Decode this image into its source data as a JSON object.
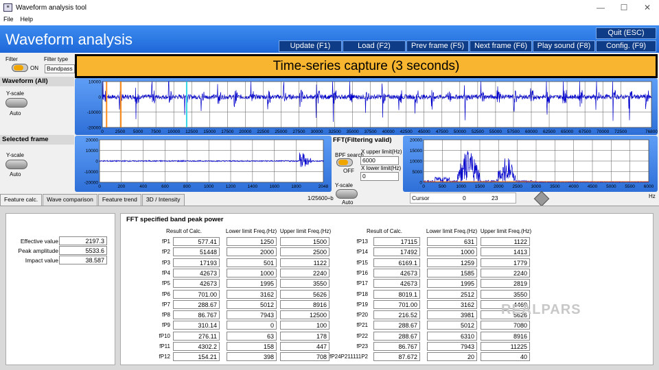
{
  "window": {
    "title": "Waveform analysis tool",
    "icon": "app-icon",
    "controls": [
      "—",
      "☐",
      "✕"
    ]
  },
  "menu": [
    "File",
    "Help"
  ],
  "header": {
    "title": "Waveform analysis",
    "buttons": {
      "quit": "Quit (ESC)",
      "update": "Update (F1)",
      "load": "Load (F2)",
      "prev": "Prev frame (F5)",
      "next": "Next frame (F6)",
      "play": "Play sound (F8)",
      "config": "Config. (F9)"
    },
    "bar_color": "#1d67d8",
    "button_color": "#0e3c87"
  },
  "filter": {
    "label": "Filter",
    "state": "ON",
    "type_label": "Filter type",
    "type_value": "Bandpass"
  },
  "banner": {
    "text": "Time-series capture (3 seconds)",
    "color": "#f7b530"
  },
  "waveform_panel": {
    "title": "Waveform (All)",
    "yscale_label": "Y-scale",
    "yscale_value": "Auto"
  },
  "selected_panel": {
    "title": "Selected frame",
    "yscale_label": "Y-scale",
    "yscale_value": "Auto",
    "sample_rate": "1/25600÷b"
  },
  "fft_panel": {
    "title": "FFT(Filtering valid)",
    "bpf_label": "BPF search",
    "bpf_state": "OFF",
    "xupper_label": "X upper limit(Hz)",
    "xupper_value": "6000",
    "xlower_label": "X lower limit(Hz)",
    "xlower_value": "0",
    "yscale_label": "Y-scale",
    "yscale_value": "Auto",
    "cursor_label": "Cursor",
    "cursor_x": "0",
    "cursor_y": "23",
    "unit": "Hz"
  },
  "tabs": [
    "Feature calc.",
    "Wave comparison",
    "Feature trend",
    "3D / Intensity"
  ],
  "active_tab": 0,
  "features": [
    {
      "label": "Effective value",
      "value": "2197.3"
    },
    {
      "label": "Peak amplitude",
      "value": "5533.6"
    },
    {
      "label": "Impact value",
      "value": "38.587"
    }
  ],
  "fft_table": {
    "title": "FFT specified band peak power",
    "headers": [
      "Result of Calc.",
      "Lower limit Freq.(Hz)",
      "Upper limit Freq.(Hz)"
    ],
    "left": [
      {
        "label": "fP1",
        "result": "577.41",
        "lower": "1250",
        "upper": "1500"
      },
      {
        "label": "fP2",
        "result": "51448",
        "lower": "2000",
        "upper": "2500"
      },
      {
        "label": "fP3",
        "result": "17193",
        "lower": "501",
        "upper": "1122"
      },
      {
        "label": "fP4",
        "result": "42673",
        "lower": "1000",
        "upper": "2240"
      },
      {
        "label": "fP5",
        "result": "42673",
        "lower": "1995",
        "upper": "3550"
      },
      {
        "label": "fP6",
        "result": "701.00",
        "lower": "3162",
        "upper": "5626"
      },
      {
        "label": "fP7",
        "result": "288.67",
        "lower": "5012",
        "upper": "8916"
      },
      {
        "label": "fP8",
        "result": "86.767",
        "lower": "7943",
        "upper": "12500"
      },
      {
        "label": "fP9",
        "result": "310.14",
        "lower": "0",
        "upper": "100"
      },
      {
        "label": "fP10",
        "result": "276.11",
        "lower": "63",
        "upper": "178"
      },
      {
        "label": "fP11",
        "result": "4302.2",
        "lower": "158",
        "upper": "447"
      },
      {
        "label": "fP12",
        "result": "154.21",
        "lower": "398",
        "upper": "708"
      }
    ],
    "right": [
      {
        "label": "fP13",
        "result": "17115",
        "lower": "631",
        "upper": "1122"
      },
      {
        "label": "fP14",
        "result": "17492",
        "lower": "1000",
        "upper": "1413"
      },
      {
        "label": "fP15",
        "result": "6169.1",
        "lower": "1259",
        "upper": "1779"
      },
      {
        "label": "fP16",
        "result": "42673",
        "lower": "1585",
        "upper": "2240"
      },
      {
        "label": "fP17",
        "result": "42673",
        "lower": "1995",
        "upper": "2819"
      },
      {
        "label": "fP18",
        "result": "8019.1",
        "lower": "2512",
        "upper": "3550"
      },
      {
        "label": "fP19",
        "result": "701.00",
        "lower": "3162",
        "upper": "4469"
      },
      {
        "label": "fP20",
        "result": "216.52",
        "lower": "3981",
        "upper": "5626"
      },
      {
        "label": "fP21",
        "result": "288.67",
        "lower": "5012",
        "upper": "7080"
      },
      {
        "label": "fP22",
        "result": "288.67",
        "lower": "6310",
        "upper": "8916"
      },
      {
        "label": "fP23",
        "result": "86.767",
        "lower": "7943",
        "upper": "11225"
      },
      {
        "label": "fP24P211111P2",
        "result": "87.672",
        "lower": "20",
        "upper": "40"
      }
    ]
  },
  "watermark": "REALPARS",
  "chart_data": [
    {
      "type": "line",
      "name_id": "waveform-all",
      "ylim": [
        -20000,
        10000
      ],
      "yticks": [
        10000,
        0,
        -10000,
        -20000
      ],
      "xlim": [
        0,
        76800
      ],
      "xticks": [
        0,
        2500,
        5000,
        7500,
        10000,
        12500,
        15000,
        17500,
        20000,
        22500,
        25000,
        27500,
        30000,
        32500,
        35000,
        37500,
        40000,
        42500,
        45000,
        47500,
        50000,
        52500,
        55000,
        57500,
        60000,
        62500,
        65000,
        67500,
        70000,
        72500,
        76800
      ],
      "markers": [
        {
          "x": 600,
          "color": "#ff8c1a"
        },
        {
          "x": 2600,
          "color": "#ff8c1a"
        },
        {
          "x": 11800,
          "color": "#33d6e6"
        }
      ],
      "impulse_period": 2300,
      "series_color": "#0000cc"
    },
    {
      "type": "line",
      "name_id": "selected-frame",
      "ylim": [
        -20000,
        20000
      ],
      "yticks": [
        20000,
        10000,
        0,
        -10000,
        -20000
      ],
      "xlim": [
        0,
        2048
      ],
      "xticks": [
        0,
        200,
        400,
        600,
        800,
        1000,
        1200,
        1400,
        1600,
        1800,
        2048
      ],
      "burst_at": 1830,
      "series_color": "#0000cc"
    },
    {
      "type": "line",
      "name_id": "fft",
      "ylim": [
        0,
        20000
      ],
      "yticks": [
        20000,
        15000,
        10000,
        5000,
        0
      ],
      "xlim": [
        0,
        6000
      ],
      "xticks": [
        0,
        500,
        1000,
        1500,
        2000,
        2500,
        3000,
        3500,
        4000,
        4500,
        5000,
        5500,
        6000
      ],
      "peak_bands": [
        {
          "from": 900,
          "to": 1500,
          "peak": 15000
        },
        {
          "from": 1950,
          "to": 2450,
          "peak": 12000
        }
      ],
      "series_color": "#0000cc"
    }
  ]
}
